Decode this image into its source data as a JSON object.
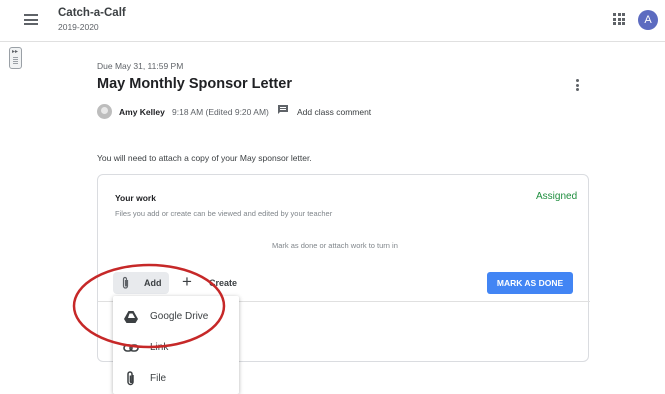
{
  "header": {
    "class_name": "Catch-a-Calf",
    "class_year": "2019-2020",
    "user_initial": "A",
    "icons": [
      "menu-icon",
      "apps-grid-icon"
    ]
  },
  "assignment": {
    "due": "Due May 31, 11:59 PM",
    "title": "May Monthly Sponsor Letter",
    "author": "Amy Kelley",
    "time": "9:18 AM (Edited 9:20 AM)",
    "add_comment": "Add class comment",
    "instructions": "You will need to attach a copy of your May sponsor letter."
  },
  "work": {
    "title": "Your work",
    "status": "Assigned",
    "description": "Files you add or create can be viewed and edited by your teacher",
    "hint": "Mark as done or attach work to turn in",
    "add_label": "Add",
    "create_symbol": "+",
    "create_label": "Create",
    "mark_done_label": "MARK AS DONE"
  },
  "menu": {
    "items": [
      {
        "label": "Google Drive",
        "icon": "google-drive-icon"
      },
      {
        "label": "Link",
        "icon": "link-icon"
      },
      {
        "label": "File",
        "icon": "paperclip-icon"
      }
    ]
  },
  "colors": {
    "accent_blue": "#4285f4",
    "status_green": "#1e8e3e",
    "avatar_purple": "#5c6bc0",
    "annotation_red": "#c62828"
  }
}
